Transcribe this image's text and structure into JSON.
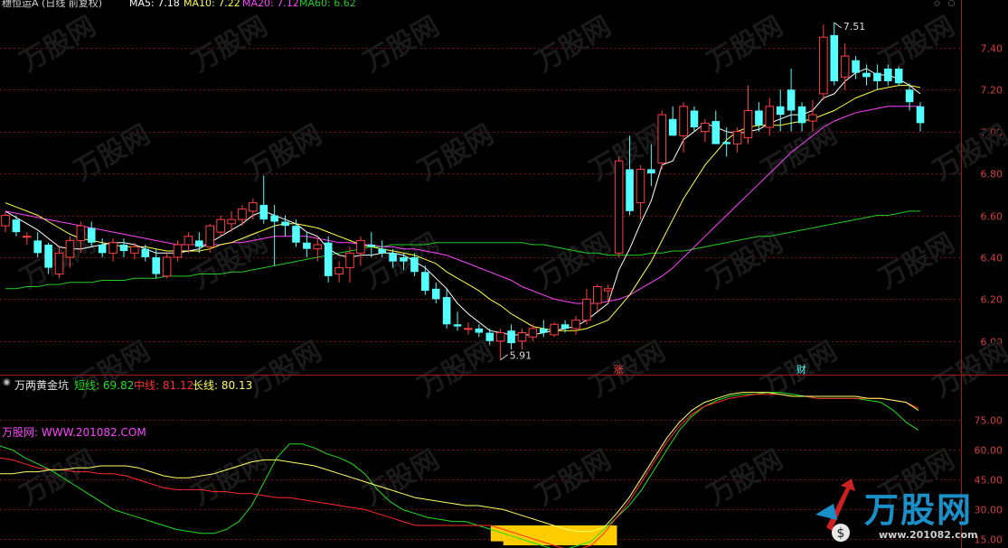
{
  "header": {
    "stock_title": "穗恒运A (日线 前复权)",
    "ma5_label": "MA5: 7.18",
    "ma10_label": "MA10: 7.22",
    "ma20_label": "MA20: 7.12",
    "ma60_label": "MA60: 6.62"
  },
  "indicator": {
    "title": "万两黄金坑",
    "short_label": "短线: 69.82",
    "mid_label": "中线: 81.12",
    "long_label": "长线: 80.13",
    "site_label": "万股网: WWW.201082.COM"
  },
  "annotations": {
    "high": "7.51",
    "low": "5.91",
    "zhang": "涨",
    "cai": "财"
  },
  "watermark": {
    "brand": "万股网",
    "url": "www.201082.com"
  },
  "colors": {
    "background": "#000000",
    "up": "#ff4040",
    "down": "#54ffff",
    "ma5": "#ffffff",
    "ma10": "#ffff44",
    "ma20": "#ff44ff",
    "ma60": "#22cc22",
    "grid": "#7a1010",
    "axis": "#d04040",
    "short_line": "#22dd22",
    "mid_line": "#ff2a2a",
    "long_line": "#ffff66",
    "pit_fill": "#ffcc00"
  },
  "chart_data": [
    {
      "type": "candlestick",
      "ylim": [
        5.87,
        7.55
      ],
      "yticks": [
        6.0,
        6.2,
        6.4,
        6.6,
        6.8,
        7.0,
        7.2,
        7.4
      ],
      "candles": [
        [
          6.55,
          6.62,
          6.52,
          6.6
        ],
        [
          6.58,
          6.6,
          6.5,
          6.52
        ],
        [
          6.5,
          6.52,
          6.46,
          6.5
        ],
        [
          6.48,
          6.52,
          6.4,
          6.42
        ],
        [
          6.46,
          6.47,
          6.32,
          6.35
        ],
        [
          6.32,
          6.45,
          6.3,
          6.42
        ],
        [
          6.4,
          6.5,
          6.35,
          6.48
        ],
        [
          6.48,
          6.57,
          6.42,
          6.55
        ],
        [
          6.54,
          6.57,
          6.45,
          6.47
        ],
        [
          6.46,
          6.49,
          6.4,
          6.42
        ],
        [
          6.42,
          6.49,
          6.38,
          6.47
        ],
        [
          6.46,
          6.49,
          6.4,
          6.43
        ],
        [
          6.42,
          6.47,
          6.39,
          6.45
        ],
        [
          6.44,
          6.46,
          6.38,
          6.4
        ],
        [
          6.4,
          6.44,
          6.3,
          6.32
        ],
        [
          6.31,
          6.42,
          6.3,
          6.4
        ],
        [
          6.4,
          6.48,
          6.38,
          6.46
        ],
        [
          6.46,
          6.52,
          6.42,
          6.5
        ],
        [
          6.48,
          6.52,
          6.42,
          6.45
        ],
        [
          6.45,
          6.56,
          6.42,
          6.55
        ],
        [
          6.52,
          6.6,
          6.5,
          6.58
        ],
        [
          6.56,
          6.62,
          6.52,
          6.58
        ],
        [
          6.58,
          6.65,
          6.55,
          6.63
        ],
        [
          6.62,
          6.68,
          6.58,
          6.66
        ],
        [
          6.65,
          6.79,
          6.56,
          6.58
        ],
        [
          6.6,
          6.65,
          6.36,
          6.57
        ],
        [
          6.57,
          6.6,
          6.5,
          6.55
        ],
        [
          6.55,
          6.58,
          6.45,
          6.47
        ],
        [
          6.47,
          6.52,
          6.4,
          6.44
        ],
        [
          6.44,
          6.5,
          6.38,
          6.46
        ],
        [
          6.47,
          6.5,
          6.28,
          6.31
        ],
        [
          6.32,
          6.38,
          6.28,
          6.35
        ],
        [
          6.35,
          6.45,
          6.28,
          6.42
        ],
        [
          6.42,
          6.5,
          6.36,
          6.48
        ],
        [
          6.46,
          6.52,
          6.4,
          6.45
        ],
        [
          6.44,
          6.48,
          6.4,
          6.42
        ],
        [
          6.42,
          6.44,
          6.35,
          6.38
        ],
        [
          6.4,
          6.42,
          6.34,
          6.38
        ],
        [
          6.4,
          6.42,
          6.31,
          6.33
        ],
        [
          6.33,
          6.36,
          6.22,
          6.24
        ],
        [
          6.25,
          6.28,
          6.18,
          6.2
        ],
        [
          6.21,
          6.25,
          6.06,
          6.08
        ],
        [
          6.08,
          6.14,
          6.05,
          6.07
        ],
        [
          6.06,
          6.09,
          6.03,
          6.06
        ],
        [
          6.06,
          6.08,
          6.02,
          6.04
        ],
        [
          6.04,
          6.06,
          5.98,
          6.0
        ],
        [
          6.0,
          6.06,
          5.91,
          6.04
        ],
        [
          6.05,
          6.08,
          5.96,
          5.99
        ],
        [
          6.0,
          6.06,
          5.96,
          6.04
        ],
        [
          6.02,
          6.08,
          6.0,
          6.06
        ],
        [
          6.06,
          6.1,
          6.02,
          6.04
        ],
        [
          6.03,
          6.09,
          6.02,
          6.08
        ],
        [
          6.08,
          6.1,
          6.04,
          6.06
        ],
        [
          6.06,
          6.12,
          6.03,
          6.1
        ],
        [
          6.1,
          6.25,
          6.08,
          6.2
        ],
        [
          6.18,
          6.27,
          6.14,
          6.26
        ],
        [
          6.24,
          6.27,
          6.18,
          6.25
        ],
        [
          6.42,
          6.88,
          6.4,
          6.86
        ],
        [
          6.82,
          6.98,
          6.6,
          6.62
        ],
        [
          6.66,
          6.84,
          6.58,
          6.82
        ],
        [
          6.82,
          6.94,
          6.74,
          6.8
        ],
        [
          6.85,
          7.1,
          6.82,
          7.08
        ],
        [
          7.06,
          7.12,
          6.98,
          6.98
        ],
        [
          6.98,
          7.14,
          6.9,
          7.12
        ],
        [
          7.1,
          7.12,
          7.0,
          7.02
        ],
        [
          7.0,
          7.06,
          6.95,
          7.04
        ],
        [
          7.05,
          7.1,
          6.96,
          6.94
        ],
        [
          6.95,
          7.02,
          6.88,
          6.94
        ],
        [
          6.94,
          7.02,
          6.9,
          7.0
        ],
        [
          6.97,
          7.22,
          6.94,
          7.1
        ],
        [
          7.1,
          7.14,
          7.0,
          7.03
        ],
        [
          7.02,
          7.16,
          6.98,
          7.12
        ],
        [
          7.12,
          7.2,
          7.0,
          7.08
        ],
        [
          7.2,
          7.3,
          7.0,
          7.1
        ],
        [
          7.12,
          7.14,
          7.0,
          7.04
        ],
        [
          7.05,
          7.15,
          7.0,
          7.08
        ],
        [
          7.18,
          7.51,
          7.15,
          7.45
        ],
        [
          7.46,
          7.52,
          7.22,
          7.24
        ],
        [
          7.26,
          7.42,
          7.2,
          7.36
        ],
        [
          7.34,
          7.36,
          7.25,
          7.28
        ],
        [
          7.28,
          7.32,
          7.22,
          7.26
        ],
        [
          7.28,
          7.32,
          7.2,
          7.24
        ],
        [
          7.3,
          7.32,
          7.22,
          7.24
        ],
        [
          7.3,
          7.31,
          7.22,
          7.23
        ],
        [
          7.2,
          7.23,
          7.1,
          7.14
        ],
        [
          7.12,
          7.14,
          7.0,
          7.04
        ]
      ],
      "ma5": [
        6.62,
        6.59,
        6.56,
        6.53,
        6.49,
        6.45,
        6.44,
        6.44,
        6.45,
        6.46,
        6.47,
        6.47,
        6.46,
        6.44,
        6.42,
        6.42,
        6.42,
        6.43,
        6.44,
        6.47,
        6.5,
        6.53,
        6.56,
        6.6,
        6.62,
        6.6,
        6.58,
        6.56,
        6.52,
        6.5,
        6.44,
        6.41,
        6.4,
        6.41,
        6.41,
        6.42,
        6.42,
        6.41,
        6.38,
        6.35,
        6.3,
        6.25,
        6.18,
        6.13,
        6.09,
        6.05,
        6.04,
        6.03,
        6.03,
        6.03,
        6.04,
        6.05,
        6.06,
        6.07,
        6.1,
        6.14,
        6.18,
        6.34,
        6.44,
        6.56,
        6.67,
        6.84,
        6.86,
        6.96,
        7.0,
        7.04,
        7.02,
        7.0,
        6.99,
        7.0,
        7.01,
        7.04,
        7.06,
        7.08,
        7.08,
        7.1,
        7.16,
        7.18,
        7.24,
        7.28,
        7.3,
        7.27,
        7.27,
        7.25,
        7.22,
        7.18
      ],
      "ma10": [
        6.66,
        6.64,
        6.62,
        6.6,
        6.57,
        6.54,
        6.51,
        6.49,
        6.48,
        6.47,
        6.46,
        6.45,
        6.45,
        6.45,
        6.44,
        6.43,
        6.43,
        6.43,
        6.43,
        6.44,
        6.46,
        6.47,
        6.49,
        6.51,
        6.53,
        6.55,
        6.56,
        6.56,
        6.55,
        6.54,
        6.52,
        6.5,
        6.48,
        6.46,
        6.45,
        6.44,
        6.43,
        6.42,
        6.41,
        6.39,
        6.37,
        6.33,
        6.3,
        6.27,
        6.24,
        6.2,
        6.17,
        6.13,
        6.1,
        6.07,
        6.06,
        6.05,
        6.05,
        6.05,
        6.06,
        6.08,
        6.1,
        6.16,
        6.22,
        6.3,
        6.38,
        6.48,
        6.58,
        6.68,
        6.76,
        6.84,
        6.9,
        6.96,
        7.0,
        7.02,
        7.03,
        7.03,
        7.03,
        7.04,
        7.05,
        7.06,
        7.08,
        7.1,
        7.13,
        7.16,
        7.18,
        7.2,
        7.21,
        7.22,
        7.22,
        7.21
      ],
      "ma20": [
        6.62,
        6.61,
        6.6,
        6.59,
        6.58,
        6.57,
        6.56,
        6.55,
        6.54,
        6.53,
        6.52,
        6.51,
        6.5,
        6.49,
        6.48,
        6.47,
        6.46,
        6.46,
        6.46,
        6.46,
        6.46,
        6.47,
        6.47,
        6.48,
        6.49,
        6.5,
        6.5,
        6.5,
        6.5,
        6.49,
        6.48,
        6.47,
        6.47,
        6.46,
        6.46,
        6.45,
        6.45,
        6.44,
        6.44,
        6.43,
        6.42,
        6.41,
        6.39,
        6.37,
        6.35,
        6.33,
        6.31,
        6.29,
        6.26,
        6.24,
        6.22,
        6.2,
        6.19,
        6.18,
        6.18,
        6.18,
        6.19,
        6.2,
        6.22,
        6.25,
        6.28,
        6.31,
        6.35,
        6.4,
        6.45,
        6.5,
        6.55,
        6.6,
        6.65,
        6.7,
        6.75,
        6.8,
        6.85,
        6.9,
        6.94,
        6.98,
        7.02,
        7.05,
        7.07,
        7.09,
        7.1,
        7.11,
        7.12,
        7.12,
        7.12,
        7.12
      ],
      "ma60": [
        6.25,
        6.25,
        6.26,
        6.26,
        6.27,
        6.27,
        6.28,
        6.28,
        6.28,
        6.29,
        6.29,
        6.29,
        6.3,
        6.3,
        6.3,
        6.31,
        6.31,
        6.31,
        6.32,
        6.32,
        6.32,
        6.33,
        6.33,
        6.34,
        6.35,
        6.36,
        6.37,
        6.38,
        6.39,
        6.4,
        6.41,
        6.42,
        6.43,
        6.44,
        6.45,
        6.45,
        6.46,
        6.46,
        6.46,
        6.46,
        6.47,
        6.47,
        6.47,
        6.47,
        6.47,
        6.47,
        6.47,
        6.47,
        6.47,
        6.46,
        6.46,
        6.45,
        6.44,
        6.43,
        6.42,
        6.42,
        6.41,
        6.41,
        6.41,
        6.41,
        6.42,
        6.42,
        6.43,
        6.43,
        6.44,
        6.45,
        6.46,
        6.47,
        6.48,
        6.49,
        6.5,
        6.5,
        6.51,
        6.52,
        6.53,
        6.54,
        6.55,
        6.56,
        6.57,
        6.58,
        6.59,
        6.6,
        6.6,
        6.61,
        6.62,
        6.62
      ]
    },
    {
      "type": "line",
      "ylim": [
        12,
        92
      ],
      "yticks": [
        15,
        30,
        45,
        60,
        75
      ],
      "series": [
        {
          "name": "短线",
          "values": [
            62,
            60,
            56,
            53,
            50,
            46,
            42,
            38,
            34,
            30,
            28,
            26,
            24,
            22,
            20,
            19,
            18,
            18,
            20,
            24,
            32,
            44,
            56,
            63,
            63,
            61,
            58,
            56,
            53,
            48,
            40,
            34,
            30,
            28,
            26,
            25,
            24,
            24,
            22,
            20,
            18,
            16,
            14,
            12,
            10,
            10,
            12,
            14,
            20,
            26,
            32,
            40,
            50,
            60,
            70,
            77,
            82,
            85,
            87,
            88,
            88,
            89,
            89,
            88,
            87,
            86,
            86,
            86,
            86,
            85,
            84,
            80,
            74,
            70
          ]
        },
        {
          "name": "中线",
          "values": [
            56,
            55,
            53,
            51,
            50,
            50,
            49,
            49,
            48,
            48,
            47,
            45,
            43,
            41,
            40,
            40,
            40,
            39,
            39,
            38,
            38,
            37,
            36,
            36,
            35,
            34,
            33,
            32,
            31,
            30,
            28,
            26,
            24,
            22,
            22,
            22,
            22,
            22,
            22,
            22,
            20,
            18,
            16,
            14,
            12,
            10,
            10,
            12,
            18,
            26,
            34,
            44,
            54,
            64,
            72,
            78,
            82,
            84,
            86,
            87,
            88,
            88,
            88,
            87,
            87,
            86,
            86,
            86,
            86,
            86,
            86,
            85,
            84,
            81
          ]
        },
        {
          "name": "长线",
          "values": [
            48,
            48,
            49,
            49,
            50,
            50,
            51,
            51,
            52,
            52,
            52,
            51,
            49,
            47,
            46,
            46,
            47,
            48,
            50,
            52,
            54,
            55,
            55,
            54,
            53,
            52,
            50,
            48,
            46,
            44,
            42,
            40,
            38,
            36,
            35,
            34,
            33,
            32,
            32,
            31,
            30,
            28,
            26,
            24,
            22,
            20,
            19,
            19,
            21,
            28,
            36,
            46,
            56,
            66,
            74,
            80,
            84,
            86,
            88,
            89,
            89,
            89,
            88,
            87,
            87,
            87,
            87,
            87,
            87,
            86,
            86,
            85,
            84,
            80
          ]
        }
      ]
    }
  ]
}
